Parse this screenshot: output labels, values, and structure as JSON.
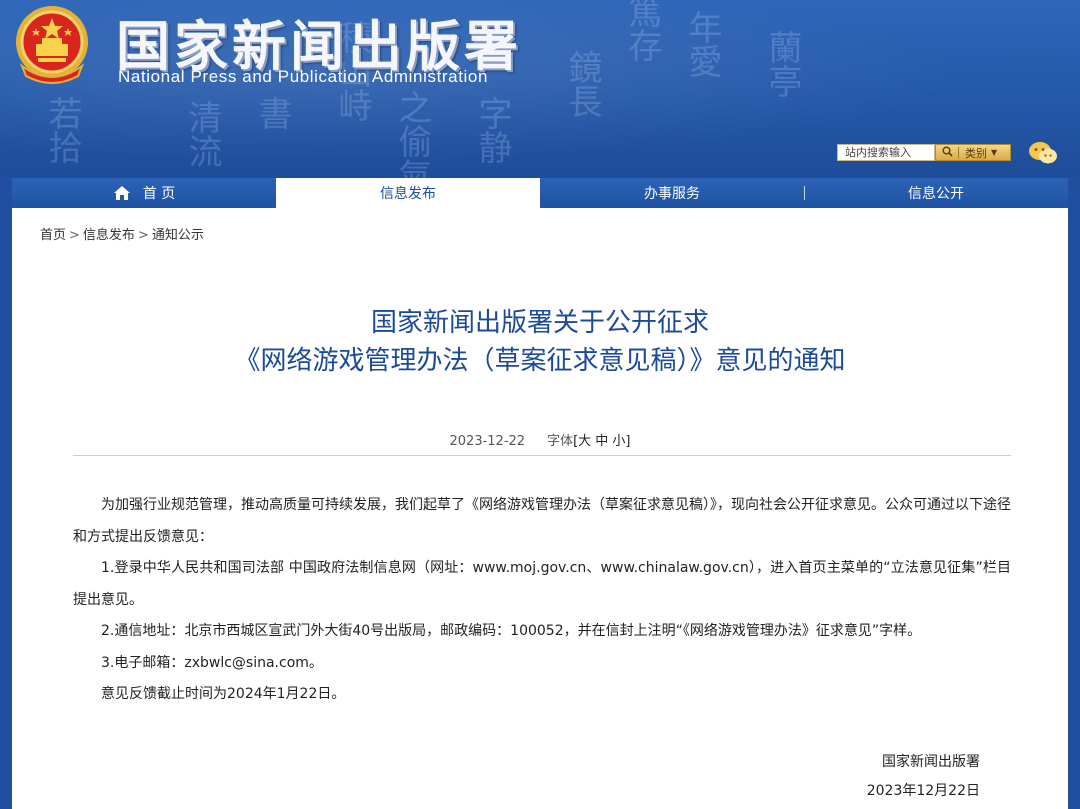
{
  "header": {
    "title_cn": "国家新闻出版署",
    "title_en": "National  Press and Publication Administration",
    "background_glyphs": [
      "積山峙",
      "之偷氣",
      "鏡長",
      "篤存",
      "年愛",
      "蘭亭",
      "清流",
      "若拾",
      "字静",
      "書"
    ],
    "search": {
      "placeholder": "站内搜索输入",
      "category_label": "类别"
    }
  },
  "nav": {
    "items": [
      {
        "label": "首 页",
        "active": false
      },
      {
        "label": "信息发布",
        "active": true
      },
      {
        "label": "办事服务",
        "active": false
      },
      {
        "label": "信息公开",
        "active": false
      }
    ]
  },
  "breadcrumb": [
    "首页",
    "信息发布",
    "通知公示"
  ],
  "article": {
    "title_line1": "国家新闻出版署关于公开征求",
    "title_line2": "《网络游戏管理办法（草案征求意见稿）》意见的通知",
    "date": "2023-12-22",
    "font_label": "字体",
    "font_sizes": "[大 中 小]",
    "paragraphs": [
      "为加强行业规范管理，推动高质量可持续发展，我们起草了《网络游戏管理办法（草案征求意见稿）》，现向社会公开征求意见。公众可通过以下途径和方式提出反馈意见：",
      "1.登录中华人民共和国司法部 中国政府法制信息网（网址：www.moj.gov.cn、www.chinalaw.gov.cn），进入首页主菜单的“立法意见征集”栏目提出意见。",
      "2.通信地址：北京市西城区宣武门外大街40号出版局，邮政编码：100052，并在信封上注明“《网络游戏管理办法》征求意见”字样。",
      "3.电子邮箱：zxbwlc@sina.com。",
      "意见反馈截止时间为2024年1月22日。"
    ],
    "signature_org": "国家新闻出版署",
    "signature_date": "2023年12月22日"
  },
  "colors": {
    "header_blue": "#2458a9",
    "title_blue": "#1c4a9a",
    "search_gold": "#d9ab47"
  }
}
